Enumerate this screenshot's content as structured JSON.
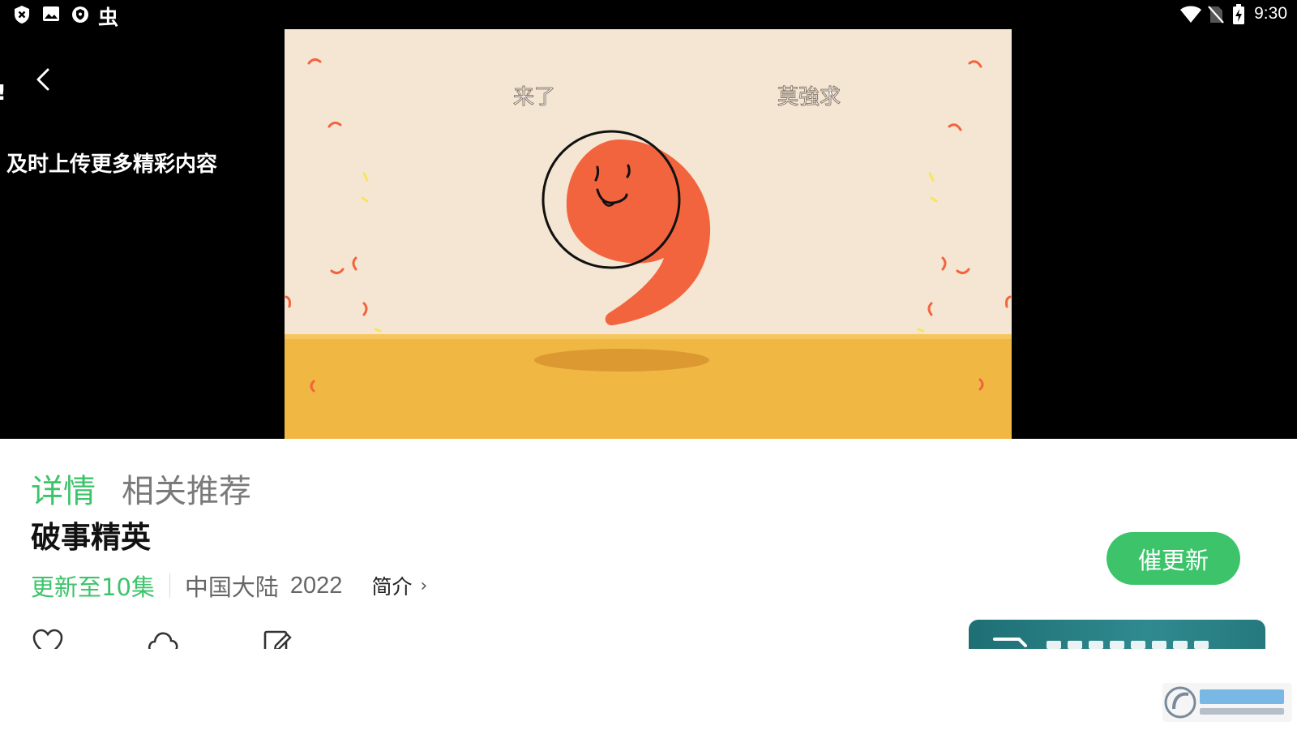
{
  "status_bar": {
    "time": "9:30",
    "left_icons": [
      "shield-x-icon",
      "image-icon",
      "vpn-shield-icon",
      "bug-icon"
    ],
    "right_icons": [
      "wifi-icon",
      "no-sim-icon",
      "battery-charging-icon"
    ]
  },
  "player": {
    "side_text_exclaim": "!",
    "side_text_hint": "及时上传更多精彩内容",
    "video_caption_left": "来了",
    "video_caption_right": "莫強求"
  },
  "tabs": [
    {
      "label": "详情",
      "active": true
    },
    {
      "label": "相关推荐",
      "active": false
    }
  ],
  "show": {
    "title": "破事精英",
    "update_status": "更新至10集",
    "region": "中国大陆",
    "year": "2022",
    "intro_label": "简介",
    "intro_chevron": "›"
  },
  "urge_update_button": "催更新",
  "actions": [
    "heart-icon",
    "cloud-download-icon",
    "edit-icon"
  ],
  "colors": {
    "accent_green": "#3dc46b",
    "video_bg": "#f4e6d2",
    "video_floor": "#f0b743",
    "mascot_orange": "#f2643e"
  }
}
